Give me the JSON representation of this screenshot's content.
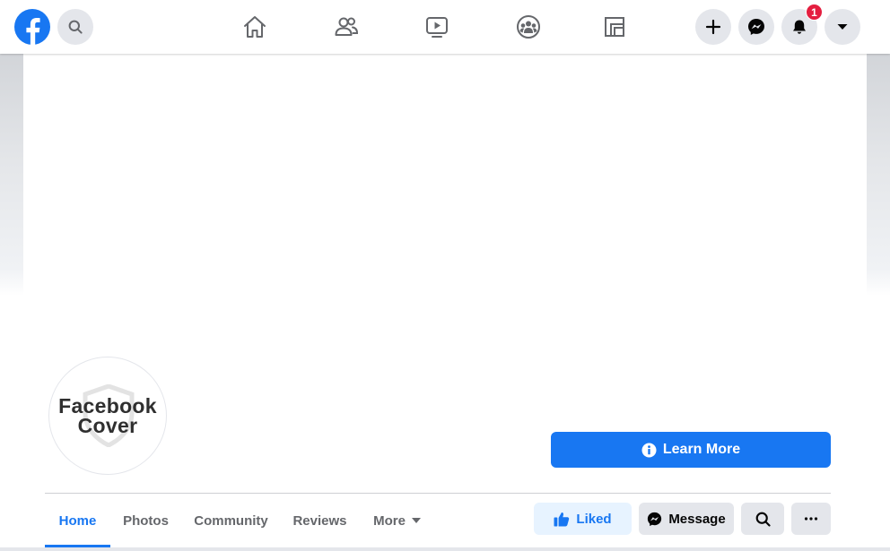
{
  "topbar": {
    "logo_icon": "facebook-logo",
    "search_icon": "search-icon",
    "nav": [
      {
        "name": "home",
        "icon": "home-icon"
      },
      {
        "name": "friends",
        "icon": "friends-icon"
      },
      {
        "name": "watch",
        "icon": "video-icon"
      },
      {
        "name": "groups",
        "icon": "groups-icon"
      },
      {
        "name": "gaming",
        "icon": "gaming-icon"
      }
    ],
    "notifications_count": "1"
  },
  "profile": {
    "avatar_line1": "Facebook",
    "avatar_line2": "Cover",
    "learn_more_label": "Learn More"
  },
  "tabs": [
    {
      "label": "Home",
      "active": true
    },
    {
      "label": "Photos"
    },
    {
      "label": "Community"
    },
    {
      "label": "Reviews"
    },
    {
      "label": "More"
    }
  ],
  "actions": {
    "liked_label": "Liked",
    "message_label": "Message"
  },
  "colors": {
    "brand": "#1877f2",
    "badge": "#e41e3f",
    "liked_bg": "#e7f3ff",
    "button_bg": "#e4e6eb"
  }
}
